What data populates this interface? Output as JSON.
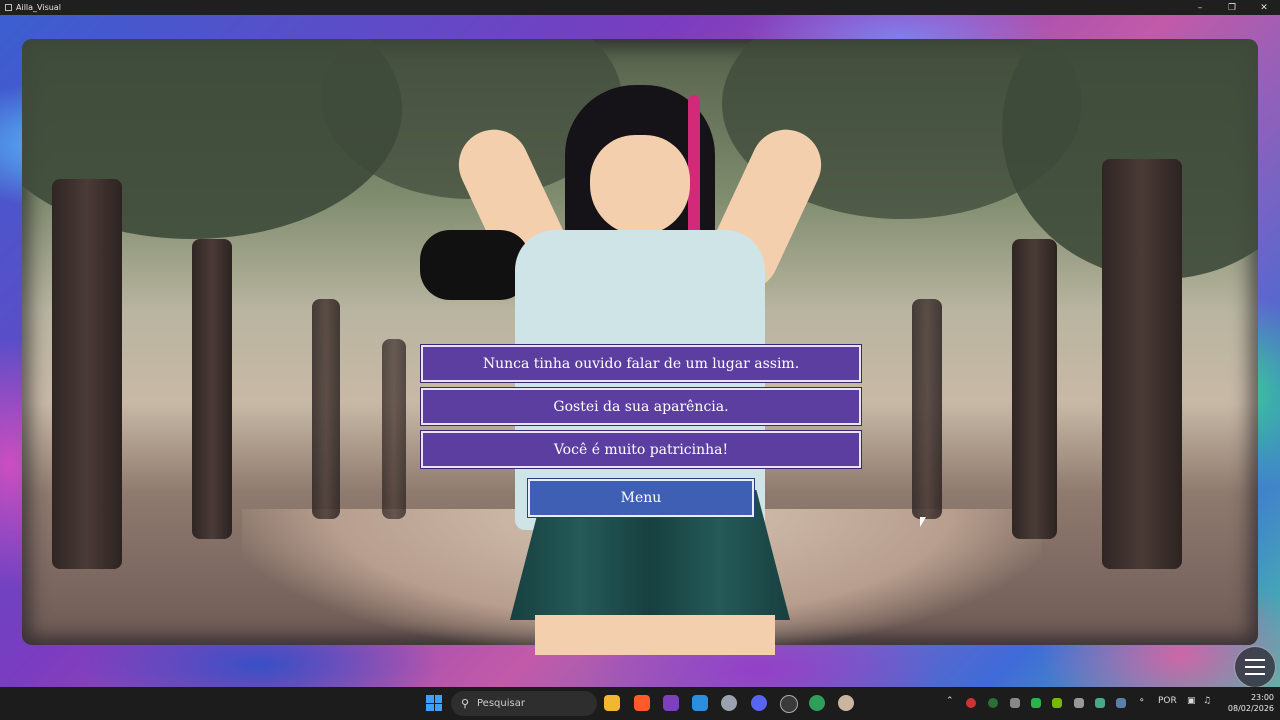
{
  "window": {
    "title": "Ailla_Visual"
  },
  "dialogue": {
    "choices": [
      "Nunca tinha ouvido falar de um lugar assim.",
      "Gostei da sua aparência.",
      "Você é muito patricinha!"
    ],
    "menu_label": "Menu"
  },
  "taskbar": {
    "search_placeholder": "Pesquisar",
    "language": "POR",
    "time": "23:00",
    "date": "08/02/2026"
  },
  "colors": {
    "choice_bg": "#5c3ea0",
    "menu_bg": "#3f5fb5",
    "windows_accent": "#3ba0ff"
  },
  "icons": {
    "hamburger": "hamburger-menu-icon",
    "search": "search-icon",
    "windows": "windows-start-icon"
  }
}
